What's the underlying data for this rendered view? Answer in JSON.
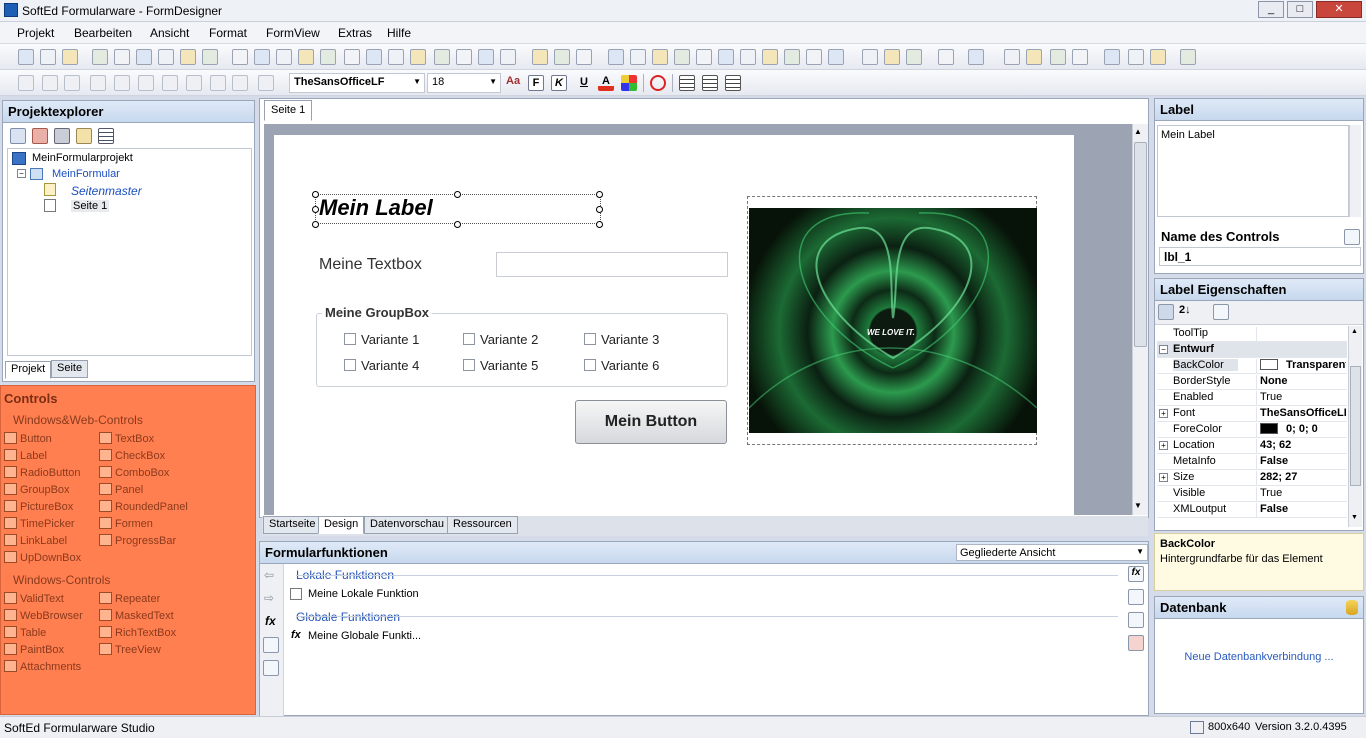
{
  "window": {
    "title": "SoftEd Formularware - FormDesigner",
    "min": "_",
    "max": "□",
    "close": "✕"
  },
  "menu": [
    "Projekt",
    "Bearbeiten",
    "Ansicht",
    "Format",
    "FormView",
    "Extras",
    "Hilfe"
  ],
  "toolbar": {
    "font_name": "TheSansOfficeLF",
    "font_size": "18",
    "bold": "F",
    "italic": "K",
    "underline": "U"
  },
  "project_explorer": {
    "title": "Projektexplorer",
    "root": "MeinFormularprojekt",
    "form": "MeinFormular",
    "master": "Seitenmaster",
    "page": "Seite 1",
    "tabs": [
      "Projekt",
      "Seite"
    ]
  },
  "controls": {
    "title": "Controls",
    "group1": "Windows&Web-Controls",
    "items1": [
      "Button",
      "TextBox",
      "Label",
      "CheckBox",
      "RadioButton",
      "ComboBox",
      "GroupBox",
      "Panel",
      "PictureBox",
      "RoundedPanel",
      "TimePicker",
      "Formen",
      "LinkLabel",
      "ProgressBar",
      "UpDownBox"
    ],
    "group2": "Windows-Controls",
    "items2": [
      "ValidText",
      "Repeater",
      "WebBrowser",
      "MaskedText",
      "Table",
      "RichTextBox",
      "PaintBox",
      "TreeView",
      "Attachments"
    ]
  },
  "designer": {
    "tab": "Seite 1",
    "label": "Mein Label",
    "textbox_label": "Meine Textbox",
    "groupbox": "Meine GroupBox",
    "options": [
      "Variante 1",
      "Variante 2",
      "Variante 3",
      "Variante 4",
      "Variante 5",
      "Variante 6"
    ],
    "button": "Mein Button",
    "image_text": "WE LOVE IT.",
    "bottom_tabs": [
      "Startseite",
      "Design",
      "Datenvorschau",
      "Ressourcen"
    ]
  },
  "functions": {
    "title": "Formularfunktionen",
    "view": "Gegliederte Ansicht",
    "local_header": "Lokale Funktionen",
    "local_item": "Meine Lokale Funktion",
    "global_header": "Globale Funktionen",
    "global_item": "Meine Globale Funkti..."
  },
  "label_panel": {
    "title": "Label",
    "text": "Mein Label",
    "name_header": "Name des Controls",
    "name": "lbl_1"
  },
  "properties": {
    "title": "Label Eigenschaften",
    "rows": [
      {
        "n": "ToolTip",
        "v": ""
      },
      {
        "n": "Entwurf",
        "v": ""
      },
      {
        "n": "BackColor",
        "v": "Transparent"
      },
      {
        "n": "BorderStyle",
        "v": "None"
      },
      {
        "n": "Enabled",
        "v": "True"
      },
      {
        "n": "Font",
        "v": "TheSansOfficeLF"
      },
      {
        "n": "ForeColor",
        "v": "0; 0; 0"
      },
      {
        "n": "Location",
        "v": "43; 62"
      },
      {
        "n": "MetaInfo",
        "v": "False"
      },
      {
        "n": "Size",
        "v": "282; 27"
      },
      {
        "n": "Visible",
        "v": "True"
      },
      {
        "n": "XMLoutput",
        "v": "False"
      }
    ]
  },
  "help": {
    "title": "BackColor",
    "text": "Hintergrundfarbe für das Element"
  },
  "database": {
    "title": "Datenbank",
    "link": "Neue Datenbankverbindung ..."
  },
  "status": {
    "left": "SoftEd Formularware Studio",
    "size": "800x640",
    "version": "Version 3.2.0.4395"
  }
}
